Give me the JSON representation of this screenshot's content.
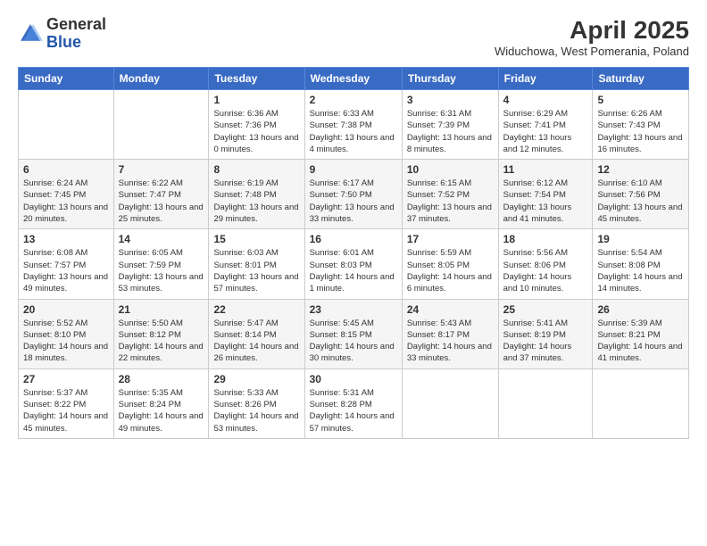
{
  "logo": {
    "general": "General",
    "blue": "Blue"
  },
  "title": {
    "main": "April 2025",
    "sub": "Widuchowa, West Pomerania, Poland"
  },
  "weekdays": [
    "Sunday",
    "Monday",
    "Tuesday",
    "Wednesday",
    "Thursday",
    "Friday",
    "Saturday"
  ],
  "weeks": [
    [
      {
        "day": "",
        "info": ""
      },
      {
        "day": "",
        "info": ""
      },
      {
        "day": "1",
        "info": "Sunrise: 6:36 AM\nSunset: 7:36 PM\nDaylight: 13 hours and 0 minutes."
      },
      {
        "day": "2",
        "info": "Sunrise: 6:33 AM\nSunset: 7:38 PM\nDaylight: 13 hours and 4 minutes."
      },
      {
        "day": "3",
        "info": "Sunrise: 6:31 AM\nSunset: 7:39 PM\nDaylight: 13 hours and 8 minutes."
      },
      {
        "day": "4",
        "info": "Sunrise: 6:29 AM\nSunset: 7:41 PM\nDaylight: 13 hours and 12 minutes."
      },
      {
        "day": "5",
        "info": "Sunrise: 6:26 AM\nSunset: 7:43 PM\nDaylight: 13 hours and 16 minutes."
      }
    ],
    [
      {
        "day": "6",
        "info": "Sunrise: 6:24 AM\nSunset: 7:45 PM\nDaylight: 13 hours and 20 minutes."
      },
      {
        "day": "7",
        "info": "Sunrise: 6:22 AM\nSunset: 7:47 PM\nDaylight: 13 hours and 25 minutes."
      },
      {
        "day": "8",
        "info": "Sunrise: 6:19 AM\nSunset: 7:48 PM\nDaylight: 13 hours and 29 minutes."
      },
      {
        "day": "9",
        "info": "Sunrise: 6:17 AM\nSunset: 7:50 PM\nDaylight: 13 hours and 33 minutes."
      },
      {
        "day": "10",
        "info": "Sunrise: 6:15 AM\nSunset: 7:52 PM\nDaylight: 13 hours and 37 minutes."
      },
      {
        "day": "11",
        "info": "Sunrise: 6:12 AM\nSunset: 7:54 PM\nDaylight: 13 hours and 41 minutes."
      },
      {
        "day": "12",
        "info": "Sunrise: 6:10 AM\nSunset: 7:56 PM\nDaylight: 13 hours and 45 minutes."
      }
    ],
    [
      {
        "day": "13",
        "info": "Sunrise: 6:08 AM\nSunset: 7:57 PM\nDaylight: 13 hours and 49 minutes."
      },
      {
        "day": "14",
        "info": "Sunrise: 6:05 AM\nSunset: 7:59 PM\nDaylight: 13 hours and 53 minutes."
      },
      {
        "day": "15",
        "info": "Sunrise: 6:03 AM\nSunset: 8:01 PM\nDaylight: 13 hours and 57 minutes."
      },
      {
        "day": "16",
        "info": "Sunrise: 6:01 AM\nSunset: 8:03 PM\nDaylight: 14 hours and 1 minute."
      },
      {
        "day": "17",
        "info": "Sunrise: 5:59 AM\nSunset: 8:05 PM\nDaylight: 14 hours and 6 minutes."
      },
      {
        "day": "18",
        "info": "Sunrise: 5:56 AM\nSunset: 8:06 PM\nDaylight: 14 hours and 10 minutes."
      },
      {
        "day": "19",
        "info": "Sunrise: 5:54 AM\nSunset: 8:08 PM\nDaylight: 14 hours and 14 minutes."
      }
    ],
    [
      {
        "day": "20",
        "info": "Sunrise: 5:52 AM\nSunset: 8:10 PM\nDaylight: 14 hours and 18 minutes."
      },
      {
        "day": "21",
        "info": "Sunrise: 5:50 AM\nSunset: 8:12 PM\nDaylight: 14 hours and 22 minutes."
      },
      {
        "day": "22",
        "info": "Sunrise: 5:47 AM\nSunset: 8:14 PM\nDaylight: 14 hours and 26 minutes."
      },
      {
        "day": "23",
        "info": "Sunrise: 5:45 AM\nSunset: 8:15 PM\nDaylight: 14 hours and 30 minutes."
      },
      {
        "day": "24",
        "info": "Sunrise: 5:43 AM\nSunset: 8:17 PM\nDaylight: 14 hours and 33 minutes."
      },
      {
        "day": "25",
        "info": "Sunrise: 5:41 AM\nSunset: 8:19 PM\nDaylight: 14 hours and 37 minutes."
      },
      {
        "day": "26",
        "info": "Sunrise: 5:39 AM\nSunset: 8:21 PM\nDaylight: 14 hours and 41 minutes."
      }
    ],
    [
      {
        "day": "27",
        "info": "Sunrise: 5:37 AM\nSunset: 8:22 PM\nDaylight: 14 hours and 45 minutes."
      },
      {
        "day": "28",
        "info": "Sunrise: 5:35 AM\nSunset: 8:24 PM\nDaylight: 14 hours and 49 minutes."
      },
      {
        "day": "29",
        "info": "Sunrise: 5:33 AM\nSunset: 8:26 PM\nDaylight: 14 hours and 53 minutes."
      },
      {
        "day": "30",
        "info": "Sunrise: 5:31 AM\nSunset: 8:28 PM\nDaylight: 14 hours and 57 minutes."
      },
      {
        "day": "",
        "info": ""
      },
      {
        "day": "",
        "info": ""
      },
      {
        "day": "",
        "info": ""
      }
    ]
  ]
}
